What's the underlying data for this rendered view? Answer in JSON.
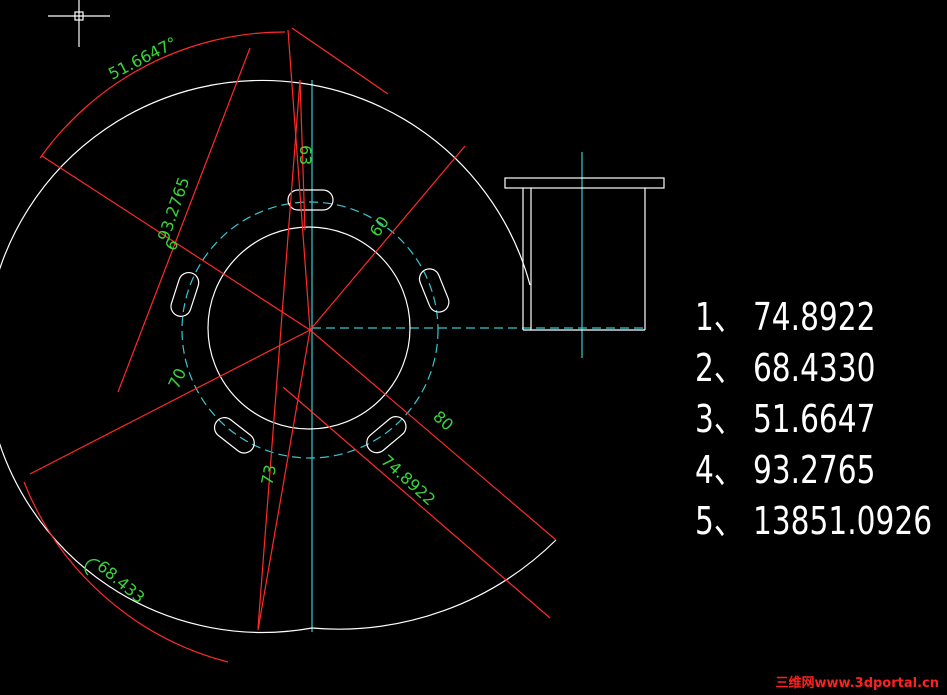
{
  "dimensions": {
    "arc_angle": "51.6647°",
    "chord_93": "93.2765",
    "arc_68": "68.433",
    "dim_74": "74.8922",
    "dim_80": "80",
    "dim_60": "60",
    "dim_63": "63",
    "dim_6": "6",
    "dim_70": "70",
    "dim_73": "73"
  },
  "results": [
    {
      "index": "1、",
      "value": "74.8922"
    },
    {
      "index": "2、",
      "value": "68.4330"
    },
    {
      "index": "3、",
      "value": "51.6647"
    },
    {
      "index": "4、",
      "value": "93.2765"
    },
    {
      "index": "5、",
      "value": "13851.0926"
    }
  ],
  "watermark": "三维网www.3dportal.cn",
  "colors": {
    "background": "#000000",
    "outline": "#ffffff",
    "centerline": "#37c7d0",
    "dimension": "#ff2a2a",
    "dim_text": "#39d43a"
  }
}
